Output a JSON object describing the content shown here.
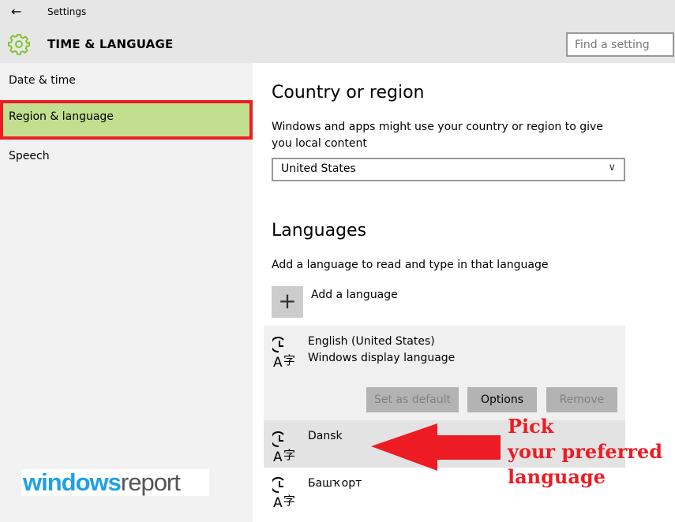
{
  "window": {
    "title": "Settings",
    "back_icon": "arrow-left-icon"
  },
  "header": {
    "section": "TIME & LANGUAGE",
    "gear_icon": "gear-icon",
    "gear_color": "#7cc024",
    "search_placeholder": "Find a setting"
  },
  "sidebar": {
    "items": [
      {
        "label": "Date & time"
      },
      {
        "label": "Region & language",
        "selected": true
      },
      {
        "label": "Speech"
      }
    ],
    "highlight_color": "#c1df8f",
    "highlight_border": "#ed1c24"
  },
  "logo": {
    "part1": "windows",
    "part2": "report"
  },
  "country": {
    "heading": "Country or region",
    "description": "Windows and apps might use your country or region to give you local content",
    "selected": "United States"
  },
  "languages": {
    "heading": "Languages",
    "description": "Add a language to read and type in that language",
    "add_label": "Add a language",
    "items": [
      {
        "name": "English (United States)",
        "subtitle": "Windows display language",
        "buttons": {
          "set_default": "Set as default",
          "options": "Options",
          "remove": "Remove"
        }
      },
      {
        "name": "Dansk"
      },
      {
        "name": "Башҡорт"
      }
    ]
  },
  "annotation": {
    "line1": "Pick",
    "line2": "your preferred",
    "line3": "language",
    "color": "#ed1c24"
  }
}
